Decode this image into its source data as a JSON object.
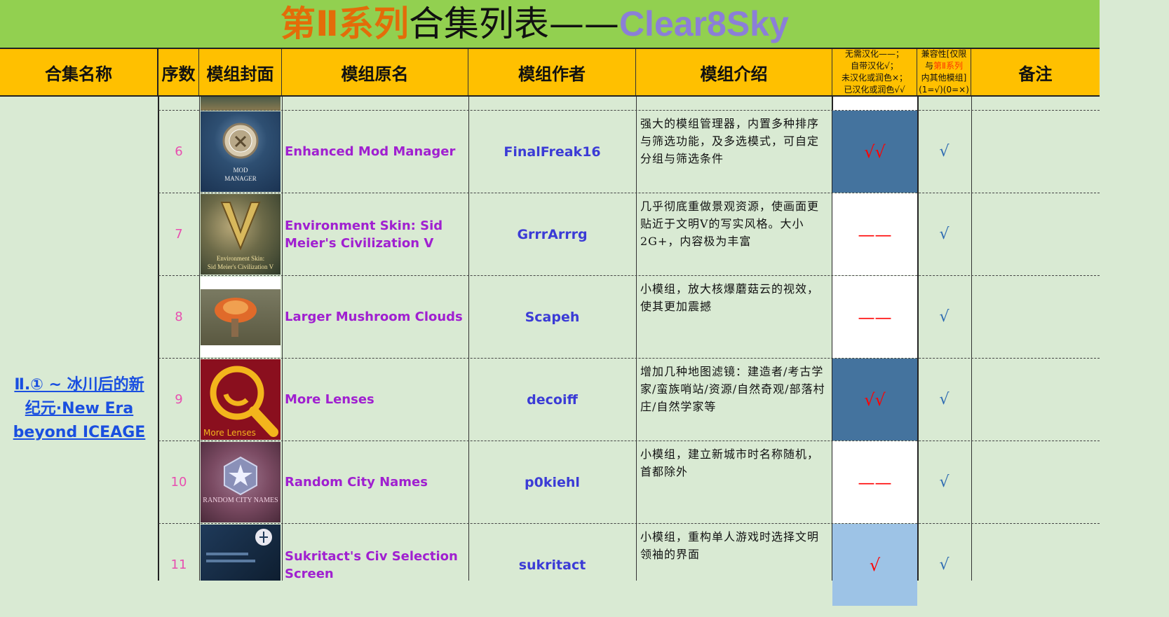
{
  "title": {
    "part1": "第Ⅱ系列",
    "part2": "合集列表——",
    "part3": "Clear8Sky"
  },
  "headers": {
    "collection": "合集名称",
    "index": "序数",
    "cover": "模组封面",
    "name": "模组原名",
    "author": "模组作者",
    "intro": "模组介绍",
    "hanhua_l1": "无需汉化——；",
    "hanhua_l2": "自带汉化√；",
    "hanhua_l3": "未汉化或润色×；",
    "hanhua_l4": "已汉化或润色√√",
    "compat_l1": "兼容性[仅限",
    "compat_l2a": "与",
    "compat_l2b": "第Ⅱ系列",
    "compat_l3": "内其他模组]",
    "compat_l4": "(1=√)(0=×)",
    "memo": "备注"
  },
  "collection_name_l1": "Ⅱ.① ~ 冰川后的新",
  "collection_name_l2": "纪元·New Era ",
  "collection_name_l3": "beyond ICEAGE",
  "colors": {
    "hanhua_dark": "#44739e",
    "hanhua_light": "#9dc3e6",
    "hanhua_white": "#ffffff"
  },
  "rows": [
    {
      "index": "6",
      "name": "Enhanced Mod Manager",
      "author": "FinalFreak16",
      "intro": "强大的模组管理器，内置多种排序与筛选功能，及多选模式，可自定分组与筛选条件",
      "hanhua": "√√",
      "compat": "√",
      "cover_text_l1": "MOD",
      "cover_text_l2": "MANAGER"
    },
    {
      "index": "7",
      "name": "Environment Skin: Sid Meier's Civilization V",
      "author": "GrrrArrrg",
      "intro": "几乎彻底重做景观资源，使画面更贴近于文明Ⅴ的写实风格。大小2G+，内容极为丰富",
      "hanhua": "——",
      "compat": "√",
      "cover_text_l1": "Environment Skin:",
      "cover_text_l2": "Sid Meier's Civilization V"
    },
    {
      "index": "8",
      "name": "Larger Mushroom Clouds",
      "author": "Scapeh",
      "intro": "小模组，放大核爆蘑菇云的视效，使其更加震撼",
      "hanhua": "——",
      "compat": "√"
    },
    {
      "index": "9",
      "name": "More Lenses",
      "author": "decoiff",
      "intro": "增加几种地图滤镜：建造者/考古学家/蛮族哨站/资源/自然奇观/部落村庄/自然学家等",
      "hanhua": "√√",
      "compat": "√",
      "cover_text_l1": "More Lenses"
    },
    {
      "index": "10",
      "name": "Random City Names",
      "author": "p0kiehl",
      "intro": "小模组，建立新城市时名称随机，首都除外",
      "hanhua": "——",
      "compat": "√",
      "cover_text_l1": "RANDOM CITY NAMES"
    },
    {
      "index": "11",
      "name": "Sukritact's Civ Selection Screen",
      "author": "sukritact",
      "intro": "小模组，重构单人游戏时选择文明领袖的界面",
      "hanhua": "√",
      "compat": "√"
    }
  ]
}
